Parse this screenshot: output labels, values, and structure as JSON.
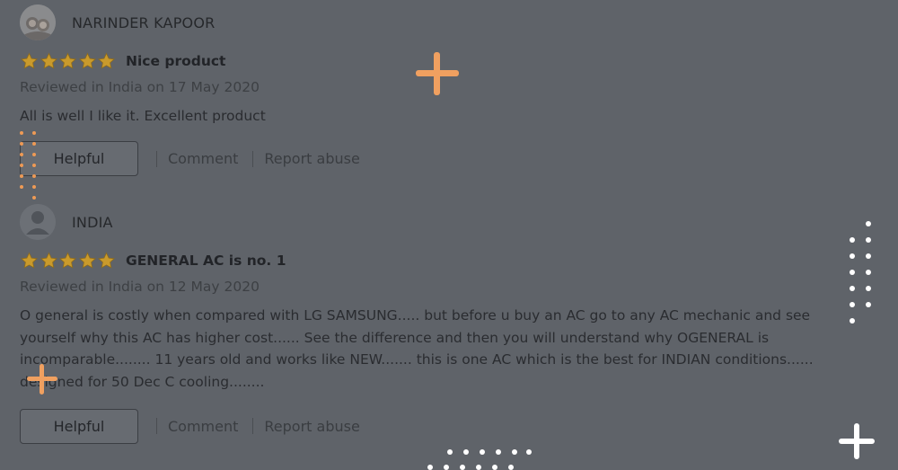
{
  "reviews": [
    {
      "reviewer": "NARINDER KAPOOR",
      "avatar": "photo-avatar",
      "stars": 5,
      "title": "Nice product",
      "date": "Reviewed in India on 17 May 2020",
      "body": "All is well I like it. Excellent product",
      "helpful_label": "Helpful",
      "comment_label": "Comment",
      "report_label": "Report abuse"
    },
    {
      "reviewer": "INDIA",
      "avatar": "default-user-icon",
      "stars": 5,
      "title": "GENERAL AC is no. 1",
      "date": "Reviewed in India on 12 May 2020",
      "body_lines": [
        "O general is costly when compared with LG SAMSUNG..... but before u buy an AC go to any AC mechanic and see",
        "yourself why this AC has higher cost...... See the difference and then you will understand why OGENERAL is",
        "incomparable........ 11 years old and works like NEW....... this is one AC which is the best for INDIAN conditions......",
        "designed for 50 Dec C cooling........"
      ],
      "helpful_label": "Helpful",
      "comment_label": "Comment",
      "report_label": "Report abuse"
    }
  ],
  "colors": {
    "overlay": "#5f6369",
    "star": "#c99a2c",
    "accent_orange": "#f0a060",
    "accent_white": "#ffffff"
  }
}
